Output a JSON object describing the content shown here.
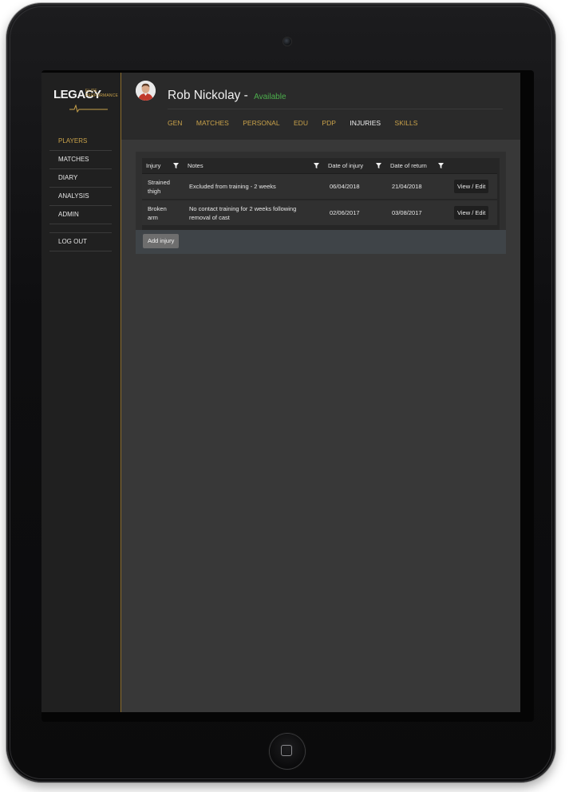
{
  "brand": {
    "logo_text": "LEGACY",
    "logo_sub_1": "ELITE",
    "logo_sub_2": "PERFORMANCE"
  },
  "sidebar": {
    "items": [
      {
        "label": "PLAYERS",
        "active": true
      },
      {
        "label": "MATCHES",
        "active": false
      },
      {
        "label": "DIARY",
        "active": false
      },
      {
        "label": "ANALYSIS",
        "active": false
      },
      {
        "label": "ADMIN",
        "active": false
      }
    ],
    "logout_label": "LOG OUT"
  },
  "header": {
    "player_name": "Rob Nickolay",
    "separator": "-",
    "status": "Available",
    "tabs": [
      {
        "label": "GEN",
        "active": false
      },
      {
        "label": "MATCHES",
        "active": false
      },
      {
        "label": "PERSONAL",
        "active": false
      },
      {
        "label": "EDU",
        "active": false
      },
      {
        "label": "PDP",
        "active": false
      },
      {
        "label": "INJURIES",
        "active": true
      },
      {
        "label": "SKILLS",
        "active": false
      }
    ]
  },
  "injuries": {
    "columns": [
      "Injury",
      "Notes",
      "Date of injury",
      "Date of return"
    ],
    "rows": [
      {
        "injury": "Strained thigh",
        "notes": "Excluded from training - 2 weeks",
        "date_of_injury": "06/04/2018",
        "date_of_return": "21/04/2018",
        "action": "View / Edit"
      },
      {
        "injury": "Broken arm",
        "notes": "No contact training for 2 weeks following removal of cast",
        "date_of_injury": "02/06/2017",
        "date_of_return": "03/08/2017",
        "action": "View / Edit"
      }
    ],
    "add_label": "Add injury"
  },
  "colors": {
    "accent": "#c9a24a",
    "status_available": "#4cae4c",
    "screen_bg": "#383838",
    "sidebar_bg": "#202020"
  },
  "icons": {
    "filter": "filter-icon",
    "home": "home-button-icon",
    "camera": "camera-icon"
  }
}
